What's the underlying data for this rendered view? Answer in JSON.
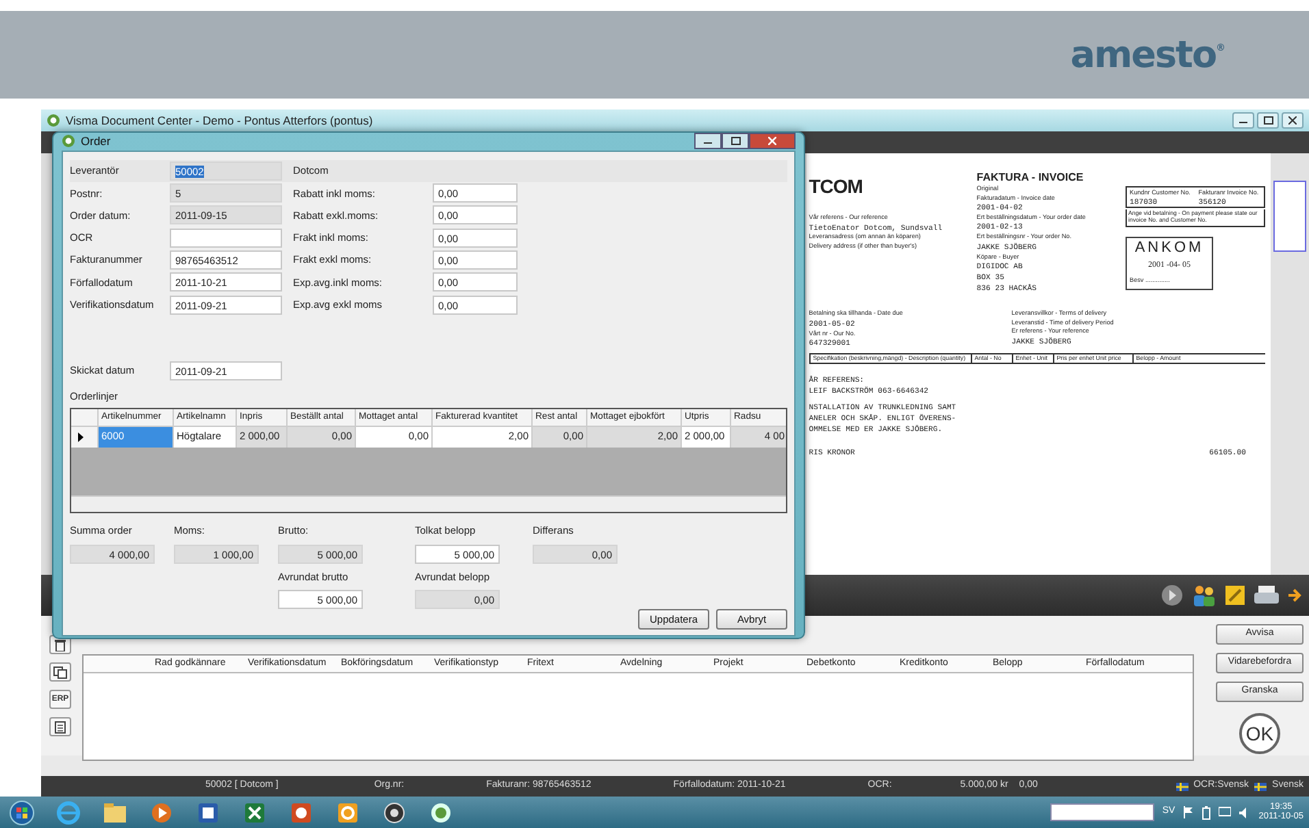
{
  "banner": {
    "logo": "amesto",
    "logo_mark": "®"
  },
  "app": {
    "title": "Visma Document Center - Demo - Pontus Atterfors (pontus)"
  },
  "order_dialog": {
    "title": "Order",
    "supplier": {
      "label": "Leverantör",
      "value": "50002",
      "name": "Dotcom"
    },
    "fields_left": [
      {
        "label": "Postnr:",
        "value": "5",
        "editable": false
      },
      {
        "label": "Order datum:",
        "value": "2011-09-15",
        "editable": false
      },
      {
        "label": "OCR",
        "editable": true
      },
      {
        "label": "Fakturanummer",
        "value": "98765463512",
        "editable": true
      },
      {
        "label": "Förfallodatum",
        "value": "2011-10-21",
        "editable": true
      },
      {
        "label": "Verifikationsdatum",
        "value": "2011-09-21",
        "editable": true
      }
    ],
    "fields_right": [
      {
        "label": "Rabatt inkl moms:",
        "value": "0,00"
      },
      {
        "label": "Rabatt exkl.moms:",
        "value": "0,00"
      },
      {
        "label": "Frakt inkl moms:",
        "value": "0,00"
      },
      {
        "label": "Frakt exkl moms:",
        "value": "0,00"
      },
      {
        "label": "Exp.avg.inkl moms:",
        "value": "0,00"
      },
      {
        "label": "Exp.avg exkl moms",
        "value": "0,00"
      }
    ],
    "sent_date": {
      "label": "Skickat datum",
      "value": "2011-09-21"
    },
    "lines_label": "Orderlinjer",
    "grid": {
      "columns": [
        {
          "label": "Artikelnummer",
          "editable": true,
          "kind": "text"
        },
        {
          "label": "Artikelnamn",
          "editable": true,
          "kind": "text"
        },
        {
          "label": "Inpris",
          "editable": false,
          "kind": "text"
        },
        {
          "label": "Beställt antal",
          "editable": false,
          "kind": "number"
        },
        {
          "label": "Mottaget antal",
          "editable": true,
          "kind": "number"
        },
        {
          "label": "Fakturerad kvantitet",
          "editable": true,
          "kind": "number"
        },
        {
          "label": "Rest antal",
          "editable": false,
          "kind": "number"
        },
        {
          "label": "Mottaget ejbokfört",
          "editable": false,
          "kind": "number"
        },
        {
          "label": "Utpris",
          "editable": true,
          "kind": "text"
        },
        {
          "label": "Radsu",
          "editable": false,
          "kind": "number"
        }
      ],
      "rows": [
        {
          "selected": true,
          "cells": [
            {
              "text": "6000",
              "selected": true
            },
            {
              "text": "Högtalare",
              "selected": false
            },
            {
              "text": "2 000,00",
              "selected": false
            },
            {
              "text": "0,00",
              "selected": false
            },
            {
              "text": "0,00",
              "selected": false
            },
            {
              "text": "2,00",
              "selected": false
            },
            {
              "text": "0,00",
              "selected": false
            },
            {
              "text": "2,00",
              "selected": false
            },
            {
              "text": "2 000,00",
              "selected": false
            },
            {
              "text": "4 00",
              "selected": false
            }
          ]
        }
      ]
    },
    "totals": [
      {
        "label": "Summa order",
        "value": "4 000,00",
        "editable": false
      },
      {
        "label": "Moms:",
        "value": "1 000,00",
        "editable": false
      },
      {
        "label": "Brutto:",
        "value": "5 000,00",
        "editable": false
      },
      {
        "label": "Tolkat belopp",
        "value": "5 000,00",
        "editable": true
      },
      {
        "label": "Differans",
        "value": "0,00",
        "editable": false
      }
    ],
    "totals_lower": [
      {
        "label": "Avrundat brutto",
        "value": "5 000,00",
        "editable": true
      },
      {
        "label": "Avrundat belopp",
        "value": "0,00",
        "editable": false
      }
    ],
    "buttons": [
      "Uppdatera",
      "Avbryt"
    ]
  },
  "document": {
    "logo": "TCOM",
    "title": "FAKTURA - INVOICE",
    "subtitle": "Original",
    "left_lines": [
      {
        "kind": "label",
        "text": "Vår referens - Our reference"
      },
      {
        "kind": "value",
        "text": "TietoEnator Dotcom, Sundsvall"
      },
      {
        "kind": "label",
        "text": "Leveransadress (om annan än köparen)"
      },
      {
        "kind": "label",
        "text": "Delivery address (if other than buyer's)"
      }
    ],
    "right_lines": [
      {
        "kind": "label",
        "text": "Fakturadatum - Invoice date"
      },
      {
        "kind": "value",
        "text": "2001-04-02"
      },
      {
        "kind": "label",
        "text": "Ert beställningsdatum - Your order date"
      },
      {
        "kind": "value",
        "text": "2001-02-13"
      },
      {
        "kind": "label",
        "text": "Ert beställningsnr - Your order No."
      },
      {
        "kind": "value",
        "text": "JAKKE SJÖBERG"
      },
      {
        "kind": "label",
        "text": "Köpare - Buyer"
      },
      {
        "kind": "value",
        "text": "DIGIDOC AB"
      },
      {
        "kind": "value",
        "text": "BOX 35"
      },
      {
        "kind": "value",
        "text": "836 23 HACKÅS"
      }
    ],
    "box_lines": [
      {
        "kind": "label",
        "text": "Kundnr Customer No."
      },
      {
        "kind": "label",
        "text": "Fakturanr Invoice No."
      },
      {
        "kind": "value",
        "text": "187030"
      },
      {
        "kind": "value",
        "text": "356120"
      }
    ],
    "box_note": "Ange vid betalning - On payment please state our invoice No. and Customer No.",
    "stamp": {
      "title": "ANKOM",
      "date": "2001 -04- 05",
      "signature": "Besv .............."
    },
    "mid_left": [
      {
        "kind": "label",
        "text": "Betalning ska tillhanda - Date due"
      },
      {
        "kind": "value",
        "text": "2001-05-02"
      },
      {
        "kind": "label",
        "text": "Vårt nr - Our No."
      },
      {
        "kind": "value",
        "text": "647329001"
      }
    ],
    "mid_right": [
      {
        "kind": "label",
        "text": "Leveransvillkor - Terms of delivery"
      },
      {
        "kind": "label",
        "text": "Leveranstid - Time of delivery Period"
      },
      {
        "kind": "label",
        "text": "Er referens - Your reference"
      },
      {
        "kind": "value",
        "text": "JAKKE SJÖBERG"
      }
    ],
    "table_headers": [
      "Specifikation (beskrivning,mängd) - Description (quantity)",
      "Antal - No",
      "Enhet - Unit",
      "Pris per enhet Unit price",
      "Belopp - Amount"
    ],
    "body_lines": [
      "ÅR REFERENS:",
      "LEIF BACKSTRÖM 063-6646342",
      "NSTALLATION AV TRUNKLEDNING SAMT",
      "ANELER OCH SKÅP. ENLIGT ÖVERENS-",
      "OMMELSE MED ER JAKKE SJÖBERG."
    ],
    "total_label": "RIS KRONOR",
    "total_value": "66105.00"
  },
  "review_panel": {
    "erp_label": "ERP",
    "columns": [
      "Rad godkännare",
      "Verifikationsdatum",
      "Bokföringsdatum",
      "Verifikationstyp",
      "Fritext",
      "Avdelning",
      "Projekt",
      "Debetkonto",
      "Kreditkonto",
      "Belopp",
      "Förfallodatum"
    ],
    "actions": [
      "Avvisa",
      "Vidarebefordra",
      "Granska"
    ],
    "ok_button": "OK"
  },
  "status_bar": {
    "items": [
      "50002 [ Dotcom ]",
      "Org.nr:",
      "Fakturanr: 98765463512",
      "Förfallodatum: 2011-10-21",
      "OCR:",
      "5.000,00 kr",
      "0,00"
    ],
    "languages": [
      "OCR:Svensk",
      "Svensk"
    ]
  },
  "taskbar": {
    "language": "SV",
    "time": "19:35",
    "date": "2011-10-05"
  }
}
